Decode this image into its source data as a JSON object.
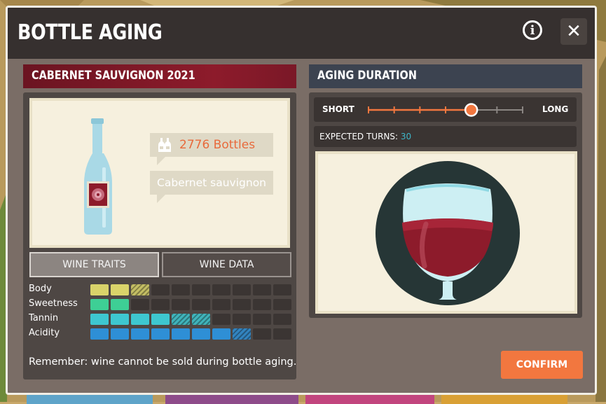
{
  "modal": {
    "title": "BOTTLE AGING",
    "info_icon": "info-icon",
    "close_icon": "close-icon",
    "close_glyph": "✕",
    "info_glyph": "i"
  },
  "wine": {
    "name": "CABERNET SAUVIGNON 2021",
    "bottles": "2776 Bottles",
    "variety": "Cabernet sauvignon",
    "bottle_icon": "bottles-icon",
    "label_icon": "rose-icon"
  },
  "tabs": [
    {
      "label": "WINE TRAITS",
      "active": true
    },
    {
      "label": "WINE DATA",
      "active": false
    }
  ],
  "traits": [
    {
      "label": "Body",
      "filled": 2,
      "partial": 1,
      "color": "#d9d36a"
    },
    {
      "label": "Sweetness",
      "filled": 2,
      "partial": 0,
      "color": "#3ecf95"
    },
    {
      "label": "Tannin",
      "filled": 4,
      "partial": 2,
      "color": "#3ec7d0"
    },
    {
      "label": "Acidity",
      "filled": 7,
      "partial": 1,
      "color": "#2e8fd6"
    }
  ],
  "trait_total_cells": 10,
  "reminder": "Remember: wine cannot be sold during bottle aging.",
  "aging": {
    "header": "AGING DURATION",
    "short_label": "SHORT",
    "long_label": "LONG",
    "steps": 7,
    "selected_step": 4,
    "expected_label": "EXPECTED TURNS: ",
    "expected_value": "30",
    "glass_icon": "wine-glass-icon"
  },
  "colors": {
    "accent": "#f2773f",
    "wine_red": "#8d1b2b"
  },
  "confirm_label": "CONFIRM"
}
